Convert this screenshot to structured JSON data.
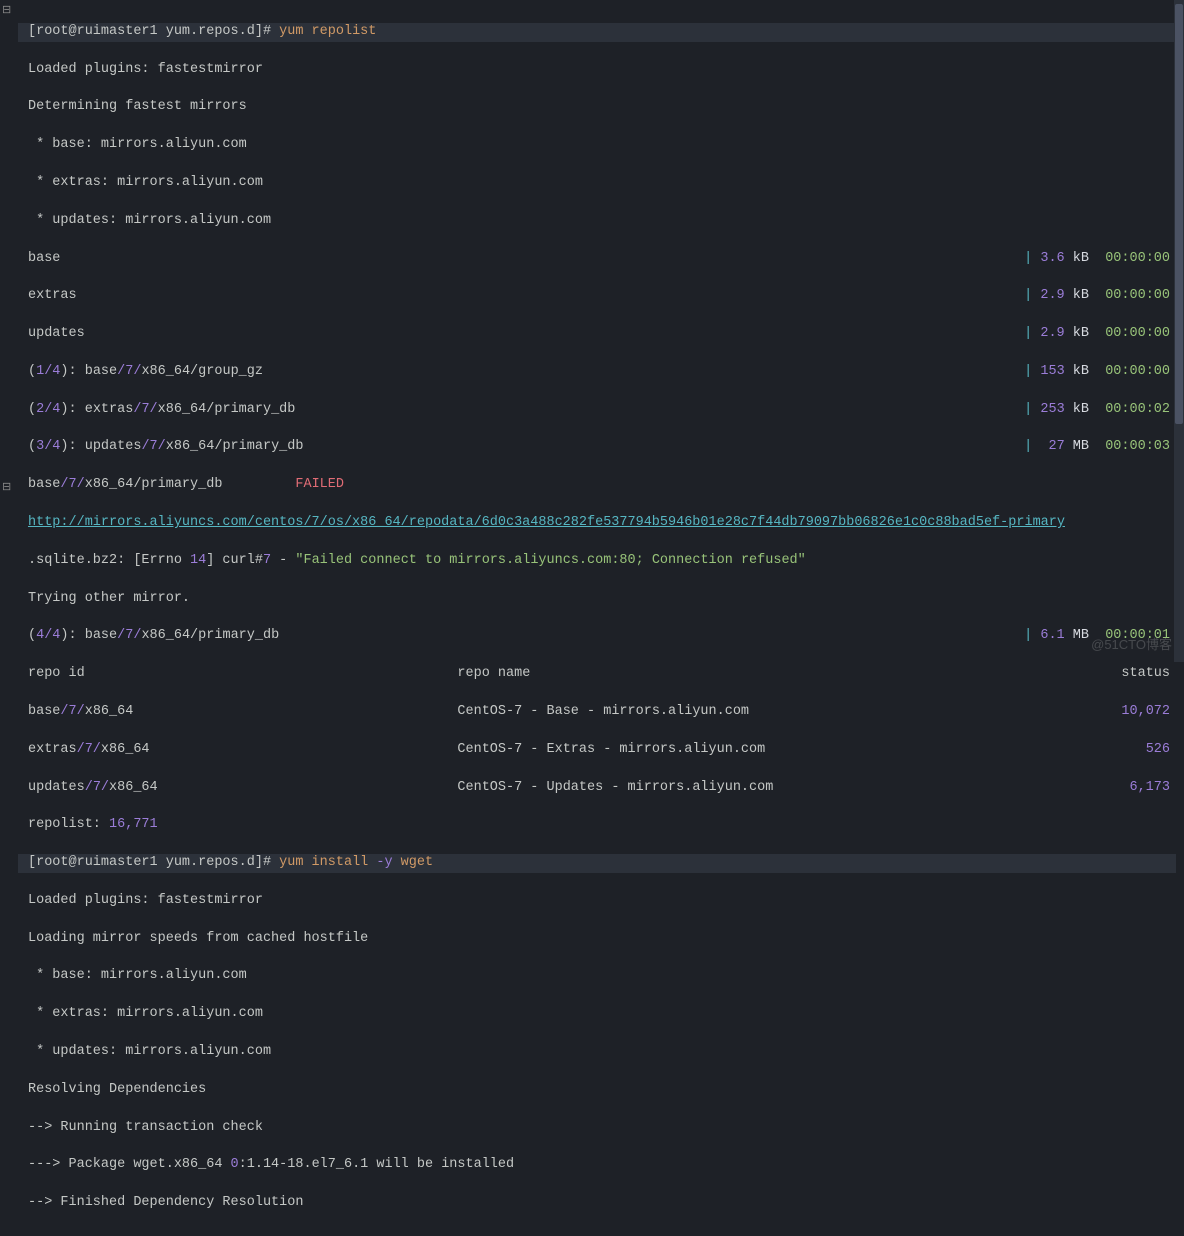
{
  "prompt1": {
    "text": "[root@ruimaster1 yum.repos.d]# ",
    "cmd": "yum repolist"
  },
  "prompt2": {
    "text": "[root@ruimaster1 yum.repos.d]# ",
    "cmd": "yum install ",
    "opt": "-y",
    "arg": " wget"
  },
  "l1": "Loaded plugins: fastestmirror",
  "l2": "Determining fastest mirrors",
  "l3": " * base: mirrors.aliyun.com",
  "l4": " * extras: mirrors.aliyun.com",
  "l5": " * updates: mirrors.aliyun.com",
  "dl": [
    {
      "name": "base",
      "size": "3.6",
      "unit": "kB",
      "time": "00:00:00"
    },
    {
      "name": "extras",
      "size": "2.9",
      "unit": "kB",
      "time": "00:00:00"
    },
    {
      "name": "updates",
      "size": "2.9",
      "unit": "kB",
      "time": "00:00:00"
    }
  ],
  "frac": [
    {
      "p": "(",
      "n": "1/4",
      "e": "): base",
      "s": "/7/",
      "f": "x86_64/group_gz",
      "size": " 153",
      "unit": "kB",
      "time": "00:00:00"
    },
    {
      "p": "(",
      "n": "2/4",
      "e": "): extras",
      "s": "/7/",
      "f": "x86_64/primary_db",
      "size": " 253",
      "unit": "kB",
      "time": "00:00:02"
    },
    {
      "p": "(",
      "n": "3/4",
      "e": "): updates",
      "s": "/7/",
      "f": "x86_64/primary_db",
      "size": "  27",
      "unit": "MB",
      "time": "00:00:03"
    }
  ],
  "fail": {
    "a": "base",
    "b": "/7/",
    "c": "x86_64/primary_db",
    "label": "FAILED"
  },
  "url": "http://mirrors.aliyuncs.com/centos/7/os/x86_64/repodata/6d0c3a488c282fe537794b5946b01e28c7f44db79097bb06826e1c0c88bad5ef-primary",
  "err": {
    "a": ".sqlite.bz2: [Errno ",
    "b": "14",
    "c": "] curl#",
    "d": "7",
    "e": " - ",
    "f": "\"Failed connect to mirrors.aliyuncs.com:80; Connection refused\""
  },
  "trying": "Trying other mirror.",
  "frac4": {
    "p": "(",
    "n": "4/4",
    "e": "): base",
    "s": "/7/",
    "f": "x86_64/primary_db",
    "size": "6.1",
    "unit": "MB",
    "time": "00:00:01"
  },
  "hdr": {
    "id": "repo id",
    "name": "repo name",
    "status": "status"
  },
  "repos": [
    {
      "id1": "base",
      "id2": "/7/",
      "id3": "x86_64",
      "name": "CentOS-7 - Base - mirrors.aliyun.com",
      "status": "10,072"
    },
    {
      "id1": "extras",
      "id2": "/7/",
      "id3": "x86_64",
      "name": "CentOS-7 - Extras - mirrors.aliyun.com",
      "status": "526"
    },
    {
      "id1": "updates",
      "id2": "/7/",
      "id3": "x86_64",
      "name": "CentOS-7 - Updates - mirrors.aliyun.com",
      "status": "6,173"
    }
  ],
  "total": {
    "a": "repolist: ",
    "b": "16,771"
  },
  "p2l1": "Loaded plugins: fastestmirror",
  "p2l2": "Loading mirror speeds from cached hostfile",
  "p2l3": " * base: mirrors.aliyun.com",
  "p2l4": " * extras: mirrors.aliyun.com",
  "p2l5": " * updates: mirrors.aliyun.com",
  "p2l6": "Resolving Dependencies",
  "p2l7": "--> Running transaction check",
  "p2l8a": "---> Package wget.x86_64 ",
  "p2l8b": "0",
  "p2l8c": ":1.14-18.el7_6.1 will be installed",
  "p2l9": "--> Finished Dependency Resolution",
  "watermark": "@51CTO博客"
}
